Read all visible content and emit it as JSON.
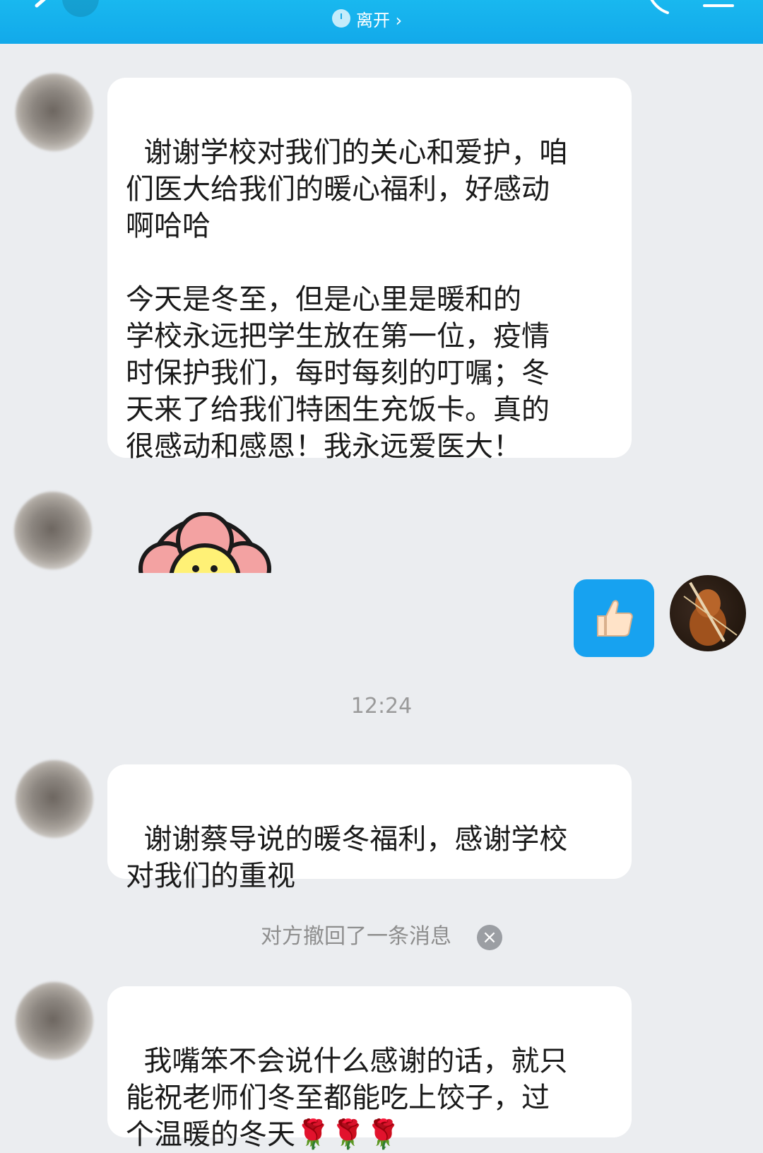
{
  "header": {
    "status_text": "离开 ›",
    "colors": {
      "bar": "#12a9ea"
    }
  },
  "messages": [
    {
      "text": "谢谢学校对我们的关心和爱护，咱\n们医大给我们的暖心福利，好感动\n啊哈哈\n\n今天是冬至，但是心里是暖和的\n学校永远把学生放在第一位，疫情\n时保护我们，每时每刻的叮嘱；冬\n天来了给我们特困生充饭卡。真的\n很感动和感恩！我永远爱医大！"
    },
    {
      "text": "谢谢蔡导说的暖冬福利，感谢学校\n对我们的重视"
    },
    {
      "text": "我嘴笨不会说什么感谢的话，就只\n能祝老师们冬至都能吃上饺子，过\n个温暖的冬天🌹🌹🌹"
    }
  ],
  "timestamp": "12:24",
  "recall_notice": "对方撤回了一条消息",
  "icons": {
    "thumb": "thumbs-up-icon",
    "flower_sticker": "flower-sticker",
    "back": "chevron-left-icon",
    "phone": "phone-icon",
    "menu": "menu-icon",
    "clock": "clock-icon"
  }
}
